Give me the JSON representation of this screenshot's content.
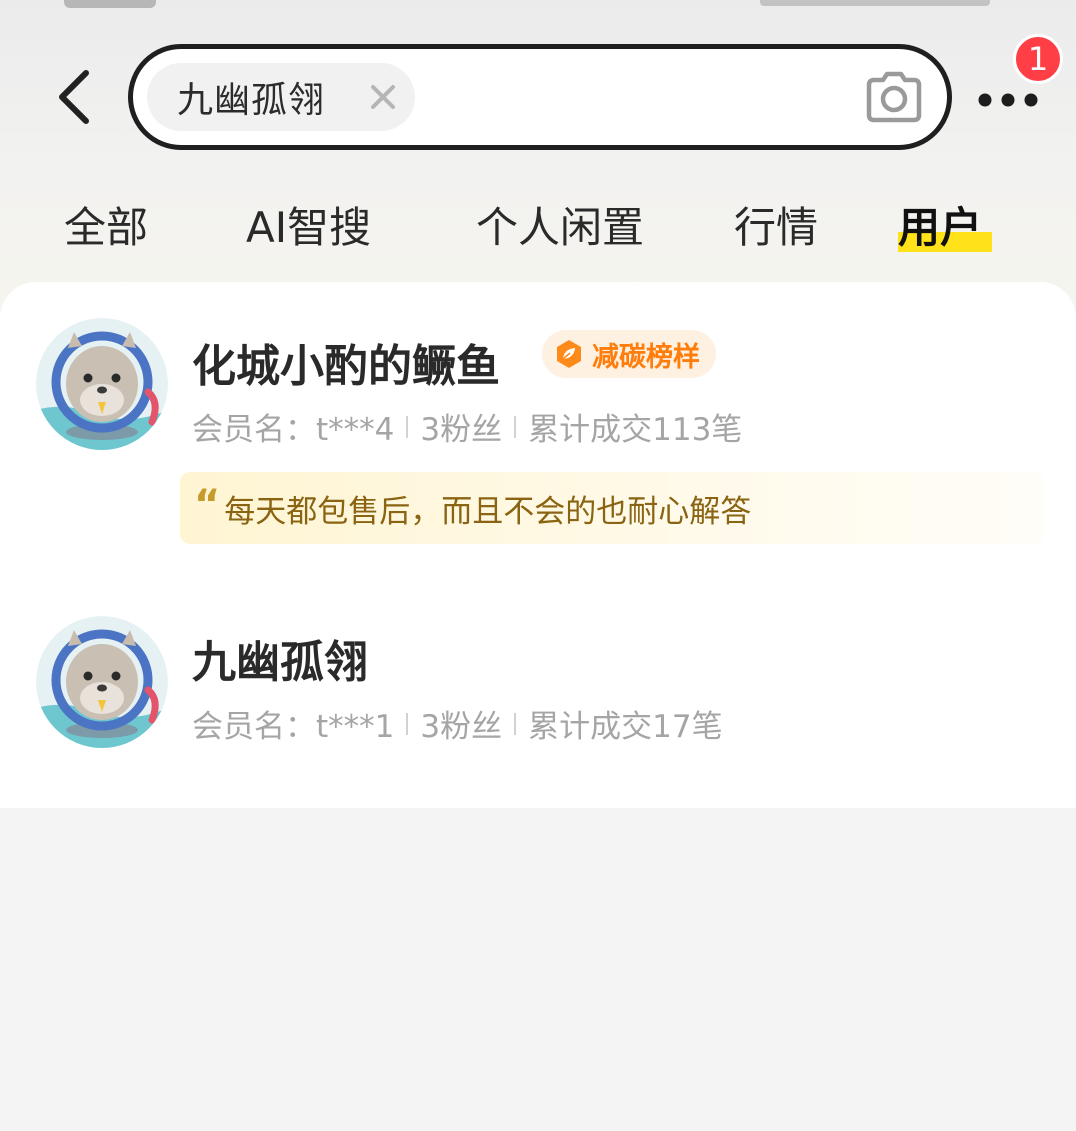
{
  "search": {
    "query": "九幽孤翎"
  },
  "header": {
    "notification_count": "1"
  },
  "tabs": [
    {
      "label": "全部",
      "active": false
    },
    {
      "label": "AI智搜",
      "active": false
    },
    {
      "label": "个人闲置",
      "active": false
    },
    {
      "label": "行情",
      "active": false
    },
    {
      "label": "用户",
      "active": true
    }
  ],
  "users": [
    {
      "name": "化城小酌的鳜鱼",
      "badge": "减碳榜样",
      "member_label": "会员名：t***4",
      "fans": "3粉丝",
      "deals": "累计成交113笔",
      "review": "每天都包售后，而且不会的也耐心解答"
    },
    {
      "name": "九幽孤翎",
      "member_label": "会员名：t***1",
      "fans": "3粉丝",
      "deals": "累计成交17笔"
    }
  ],
  "colors": {
    "accent_yellow": "#ffe21a",
    "badge_red": "#ff3f45",
    "eco_orange": "#ff7d0a",
    "review_text": "#8a6412"
  },
  "icons": [
    "back-arrow-icon",
    "clear-icon",
    "camera-icon",
    "more-icon",
    "leaf-icon",
    "quote-icon",
    "avatar-seal-image"
  ]
}
